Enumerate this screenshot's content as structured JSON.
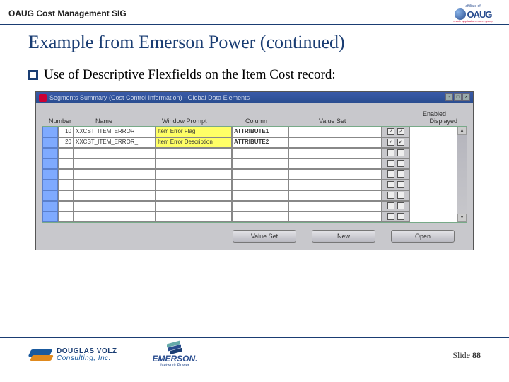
{
  "header": {
    "sig": "OAUG Cost Management SIG",
    "affiliate": "affiliate of",
    "oaug_text": "OAUG",
    "oaug_tag": "oracle applications users group"
  },
  "slide": {
    "title": "Example from Emerson Power (continued)",
    "bullet": "Use of Descriptive Flexfields on the Item Cost record:",
    "number_label": "Slide ",
    "number": "88"
  },
  "window": {
    "title": "Segments Summary (Cost Control Information) - Global Data Elements",
    "labels": {
      "number": "Number",
      "name": "Name",
      "window_prompt": "Window Prompt",
      "column": "Column",
      "value_set": "Value Set",
      "enabled": "Enabled",
      "displayed": "Displayed"
    },
    "rows": [
      {
        "seq": "10",
        "name": "XXCST_ITEM_ERROR_",
        "prompt": "Item Error Flag",
        "col": "ATTRIBUTE1",
        "vs": "",
        "en": true,
        "disp": true
      },
      {
        "seq": "20",
        "name": "XXCST_ITEM_ERROR_",
        "prompt": "Item Error Description",
        "col": "ATTRIBUTE2",
        "vs": "",
        "en": true,
        "disp": true
      }
    ],
    "buttons": {
      "value_set": "Value Set",
      "new": "New",
      "open": "Open"
    }
  },
  "footer": {
    "dv1": "DOUGLAS VOLZ",
    "dv2": "Consulting, Inc.",
    "em1": "EMERSON.",
    "em2": "Network Power"
  }
}
